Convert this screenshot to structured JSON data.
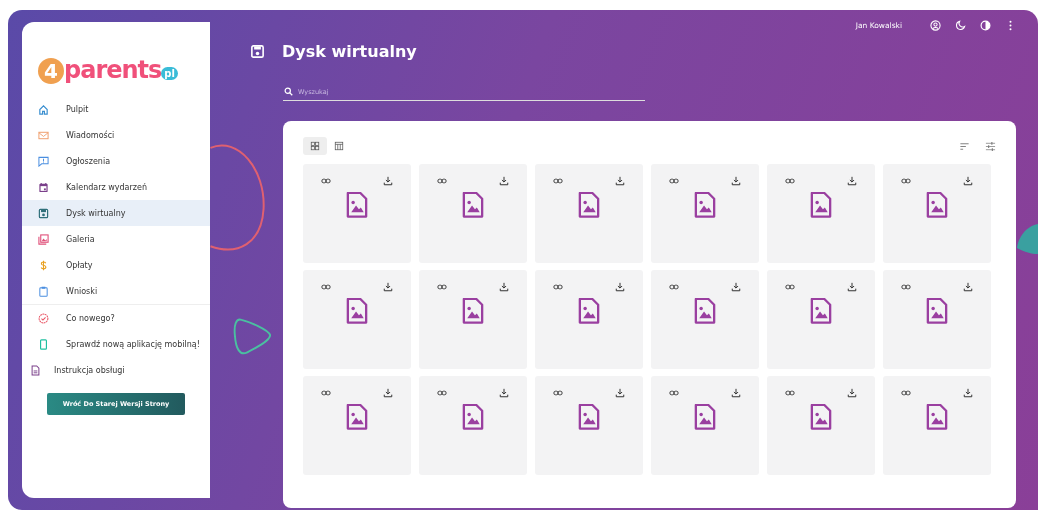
{
  "logo": {
    "digit": "4",
    "word": "parents",
    "suffix": "pl"
  },
  "sidebar": {
    "sections": [
      [
        {
          "kind": "nav",
          "label": "Pulpit",
          "selected": false
        },
        {
          "kind": "nav",
          "label": "Wiadomości",
          "selected": false
        },
        {
          "kind": "nav",
          "label": "Ogłoszenia",
          "selected": false
        },
        {
          "kind": "nav",
          "label": "Kalendarz wydarzeń",
          "selected": false
        },
        {
          "kind": "nav",
          "label": "Dysk wirtualny",
          "selected": true
        },
        {
          "kind": "nav",
          "label": "Galeria",
          "selected": false
        },
        {
          "kind": "nav",
          "label": "Opłaty",
          "selected": false
        },
        {
          "kind": "nav",
          "label": "Wnioski",
          "selected": false
        }
      ],
      [
        {
          "kind": "nav",
          "label": "Co nowego?",
          "selected": false
        },
        {
          "kind": "nav",
          "label": "Sprawdź nową aplikację mobilną!",
          "selected": false
        },
        {
          "kind": "doc",
          "label": "Instrukcja obsługi",
          "selected": false
        }
      ]
    ],
    "old_version_button": "Wróć Do Starej Wersji Strony"
  },
  "topbar": {
    "user": "Jan Kowalski"
  },
  "page": {
    "title": "Dysk wirtualny",
    "search": {
      "placeholder": "Wyszukaj"
    }
  },
  "view_toggle": [
    {
      "kind": "grid",
      "selected": true
    },
    {
      "kind": "table",
      "selected": false
    }
  ],
  "files": [
    {
      "kind": "image"
    },
    {
      "kind": "image"
    },
    {
      "kind": "image"
    },
    {
      "kind": "image"
    },
    {
      "kind": "image"
    },
    {
      "kind": "image"
    },
    {
      "kind": "image"
    },
    {
      "kind": "image"
    },
    {
      "kind": "image"
    },
    {
      "kind": "image"
    },
    {
      "kind": "image"
    },
    {
      "kind": "image"
    },
    {
      "kind": "image"
    },
    {
      "kind": "image"
    },
    {
      "kind": "image"
    },
    {
      "kind": "image"
    },
    {
      "kind": "image"
    },
    {
      "kind": "image"
    }
  ]
}
